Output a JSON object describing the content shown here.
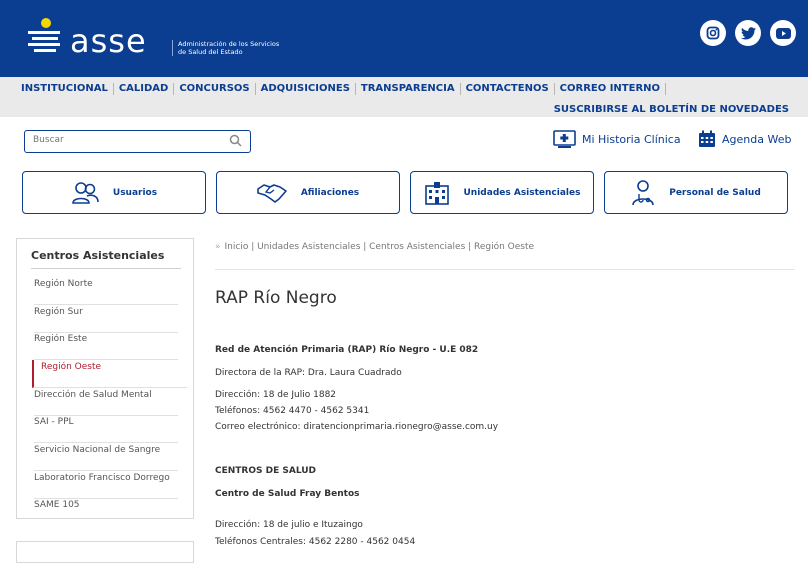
{
  "header": {
    "logo_text": "asse",
    "logo_subtitle": "Administración de los Servicios de Salud del Estado",
    "social": [
      "instagram-icon",
      "twitter-icon",
      "youtube-icon"
    ],
    "brand_color": "#0b3d91"
  },
  "nav": {
    "items": [
      "INSTITUCIONAL",
      "CALIDAD",
      "CONCURSOS",
      "ADQUISICIONES",
      "TRANSPARENCIA",
      "CONTACTENOS",
      "CORREO INTERNO"
    ],
    "newsletter": "SUSCRIBIRSE AL BOLETÍN DE NOVEDADES"
  },
  "search": {
    "placeholder": "Buscar"
  },
  "quick_links": {
    "historia": "Mi Historia Clínica",
    "agenda": "Agenda Web"
  },
  "cards": [
    "Usuarios",
    "Afiliaciones",
    "Unidades Asistenciales",
    "Personal de Salud"
  ],
  "sidebar": {
    "title": "Centros Asistenciales",
    "items": [
      "Región Norte",
      "Región Sur",
      "Región Este",
      "Región Oeste",
      "Dirección de Salud Mental",
      "SAI - PPL",
      "Servicio Nacional de Sangre",
      "Laboratorio Francisco Dorrego",
      "SAME 105"
    ],
    "active": "Región Oeste",
    "active_color": "#b01c2e"
  },
  "breadcrumb": "Inicio | Unidades Asistenciales | Centros Asistenciales | Región Oeste",
  "content": {
    "title": "RAP Río Negro",
    "rap_heading": "Red de Atención Primaria (RAP) Río Negro - U.E 082",
    "directora": "Directora de la RAP: Dra. Laura Cuadrado",
    "direccion": "Dirección: 18 de Julio 1882",
    "telefonos": "Teléfonos: 4562 4470 - 4562 5341",
    "correo": "Correo electrónico: diratencionprimaria.rionegro@asse.com.uy",
    "centros_heading": "CENTROS DE SALUD",
    "centro1_name": "Centro de Salud Fray Bentos",
    "centro1_direccion": "Dirección: 18 de julio e Ituzaingo",
    "centro1_telefonos": "Teléfonos Centrales: 4562 2280 - 4562 0454"
  }
}
